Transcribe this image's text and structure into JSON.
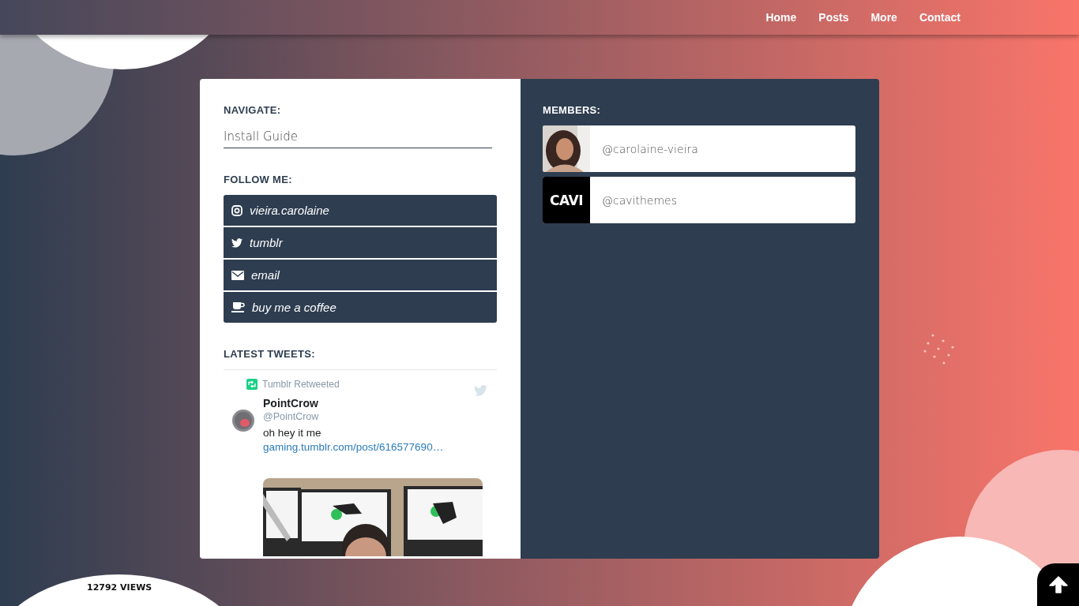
{
  "nav": {
    "links": [
      "Home",
      "Posts",
      "More",
      "Contact"
    ]
  },
  "navigate": {
    "heading": "NAVIGATE:",
    "value": "Install Guide"
  },
  "follow": {
    "heading": "FOLLOW ME:",
    "links": [
      {
        "kind": "instagram",
        "label": "vieira.carolaine"
      },
      {
        "kind": "twitter",
        "label": "tumblr"
      },
      {
        "kind": "email",
        "label": "email"
      },
      {
        "kind": "coffee",
        "label": "buy me a coffee"
      }
    ]
  },
  "tweets": {
    "heading": "LATEST TWEETS:",
    "retweet_label": "Tumblr Retweeted",
    "name": "PointCrow",
    "handle": "@PointCrow",
    "text": "oh hey it me",
    "link": "gaming.tumblr.com/post/616577690…"
  },
  "members": {
    "heading": "MEMBERS:",
    "items": [
      {
        "handle": "@carolaine-vieira"
      },
      {
        "kind": "logo",
        "logo_text": "CAVI",
        "handle": "@cavithemes"
      }
    ]
  },
  "views": "12792 VIEWS"
}
